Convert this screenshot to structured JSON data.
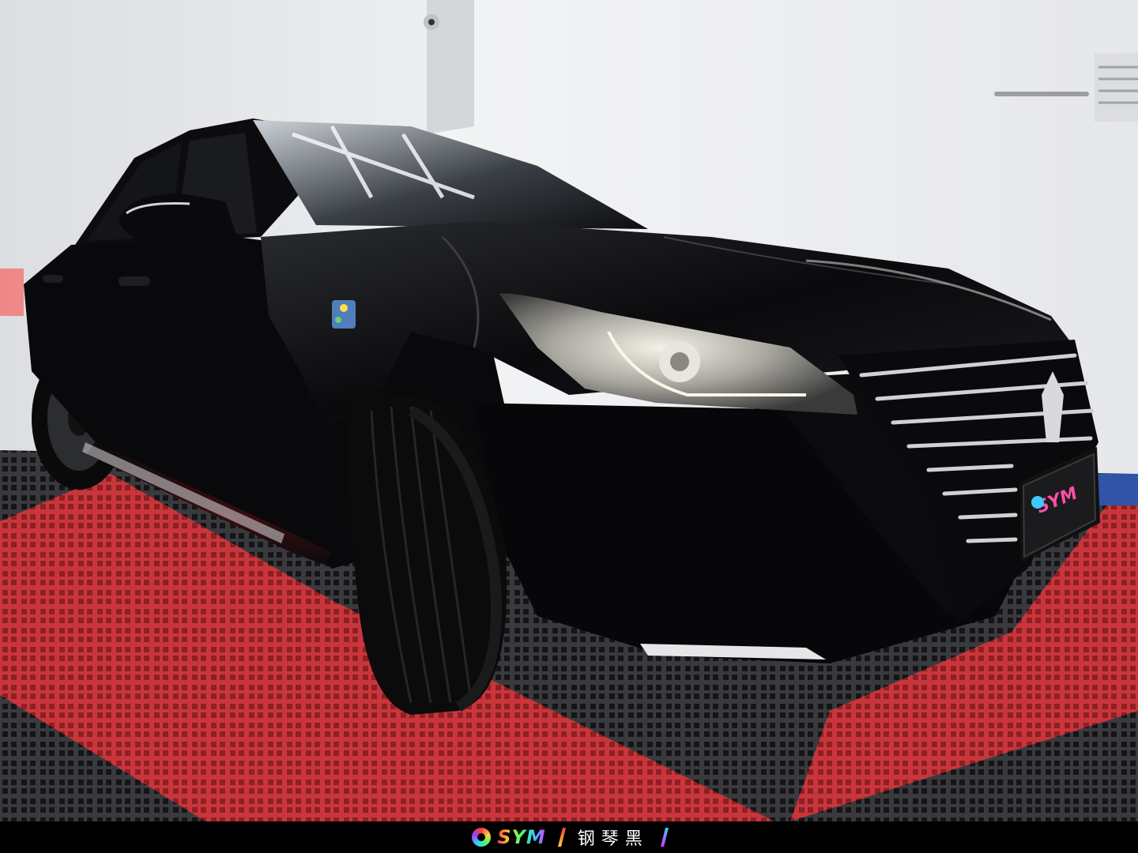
{
  "footer": {
    "brand": "SYM",
    "paint_name": "钢琴黑"
  },
  "plate": {
    "brand": "SYM"
  },
  "colors": {
    "wall": "#e9eaec",
    "floor_red": "#c7363a",
    "floor_dark": "#2b2b2e",
    "car_body": "#08080a"
  }
}
